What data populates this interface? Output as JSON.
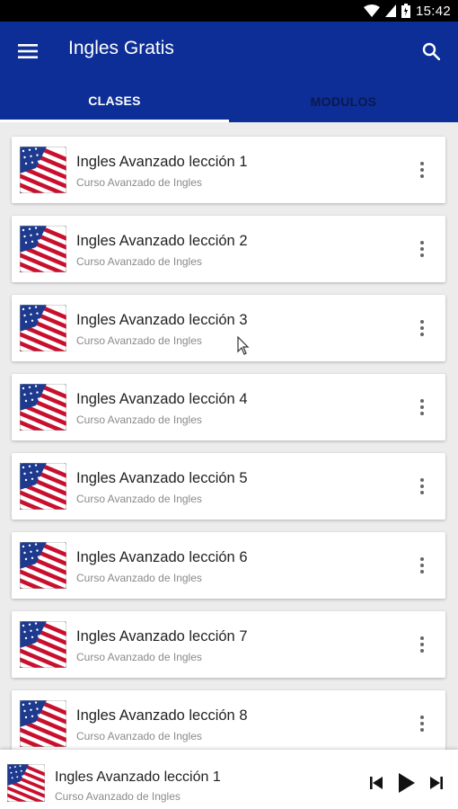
{
  "status_bar": {
    "time": "15:42",
    "icons": [
      "wifi-icon",
      "signal-icon",
      "battery-icon"
    ]
  },
  "app_bar": {
    "title": "Ingles Gratis",
    "menu_icon": "menu-icon",
    "search_icon": "search-icon",
    "color": "#0d2e96"
  },
  "tabs": [
    {
      "label": "CLASES",
      "active": true
    },
    {
      "label": "MODULOS",
      "active": false
    }
  ],
  "lessons": [
    {
      "title": "Ingles Avanzado lección 1",
      "subtitle": "Curso Avanzado de Ingles"
    },
    {
      "title": "Ingles Avanzado lección 2",
      "subtitle": "Curso Avanzado de Ingles"
    },
    {
      "title": "Ingles Avanzado lección 3",
      "subtitle": "Curso Avanzado de Ingles"
    },
    {
      "title": "Ingles Avanzado lección 4",
      "subtitle": "Curso Avanzado de Ingles"
    },
    {
      "title": "Ingles Avanzado lección 5",
      "subtitle": "Curso Avanzado de Ingles"
    },
    {
      "title": "Ingles Avanzado lección 6",
      "subtitle": "Curso Avanzado de Ingles"
    },
    {
      "title": "Ingles Avanzado lección 7",
      "subtitle": "Curso Avanzado de Ingles"
    },
    {
      "title": "Ingles Avanzado lección 8",
      "subtitle": "Curso Avanzado de Ingles"
    }
  ],
  "player": {
    "title": "Ingles Avanzado lección 1",
    "subtitle": "Curso Avanzado de Ingles",
    "controls": [
      "skip-previous-icon",
      "play-icon",
      "skip-next-icon"
    ]
  }
}
